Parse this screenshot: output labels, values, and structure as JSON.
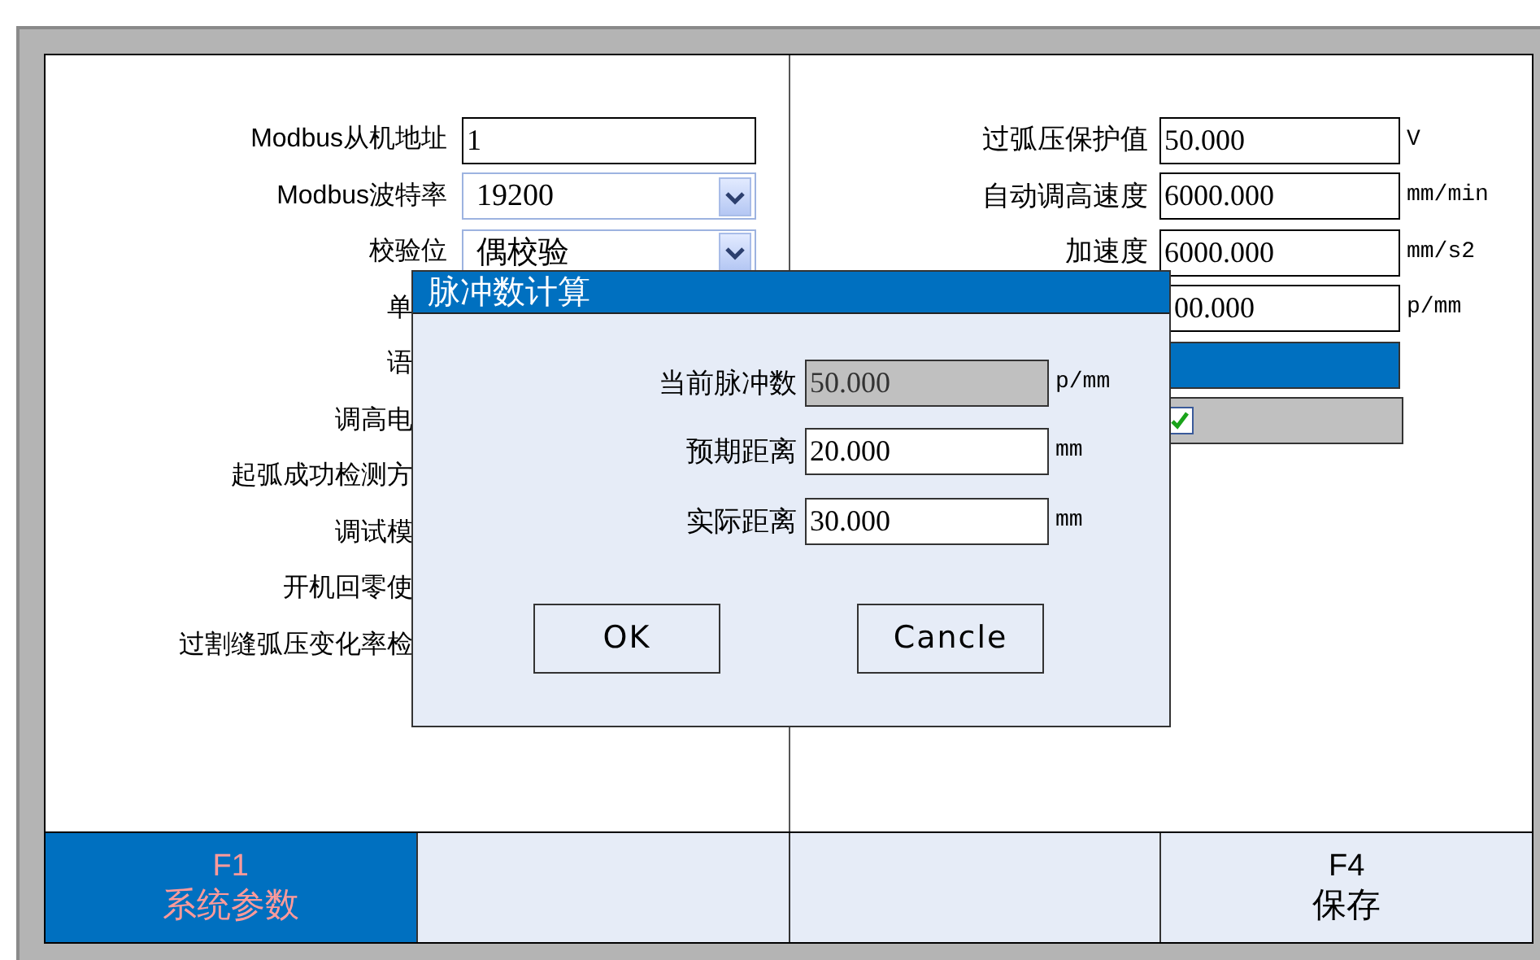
{
  "left_rows": [
    {
      "kind": "input",
      "label": "Modbus从机地址",
      "value": "1"
    },
    {
      "kind": "select",
      "label": "Modbus波特率",
      "value": "19200"
    },
    {
      "kind": "select",
      "label": "校验位",
      "value": "偶校验"
    },
    {
      "kind": "label",
      "label": "单"
    },
    {
      "kind": "label",
      "label": "语"
    },
    {
      "kind": "label",
      "label": "调高电"
    },
    {
      "kind": "label",
      "label": "起弧成功检测方"
    },
    {
      "kind": "label",
      "label": "调试模"
    },
    {
      "kind": "label",
      "label": "开机回零使"
    },
    {
      "kind": "label",
      "label": "过割缝弧压变化率检"
    }
  ],
  "right_rows": [
    {
      "kind": "input",
      "label": "过弧压保护值",
      "value": "50.000",
      "unit": "V"
    },
    {
      "kind": "input",
      "label": "自动调高速度",
      "value": "6000.000",
      "unit": "mm/min"
    },
    {
      "kind": "input",
      "label": "加速度",
      "value": "6000.000",
      "unit": "mm/s2"
    },
    {
      "kind": "input",
      "value": "00.000",
      "unit": "p/mm"
    },
    {
      "kind": "bar"
    },
    {
      "kind": "checkbox",
      "checked": true
    }
  ],
  "dialog": {
    "title": "脉冲数计算",
    "fields": [
      {
        "label": "当前脉冲数",
        "value": "50.000",
        "unit": "p/mm",
        "readonly": true
      },
      {
        "label": "预期距离",
        "value": "20.000",
        "unit": "mm",
        "readonly": false
      },
      {
        "label": "实际距离",
        "value": "30.000",
        "unit": "mm",
        "readonly": false
      }
    ],
    "buttons": [
      "OK",
      "Cancle"
    ]
  },
  "function_keys": [
    {
      "key": "F1",
      "label": "系统参数",
      "selected": true
    },
    {
      "selected": false
    },
    {
      "selected": false
    },
    {
      "key": "F4",
      "label": "保存",
      "selected": false
    }
  ]
}
